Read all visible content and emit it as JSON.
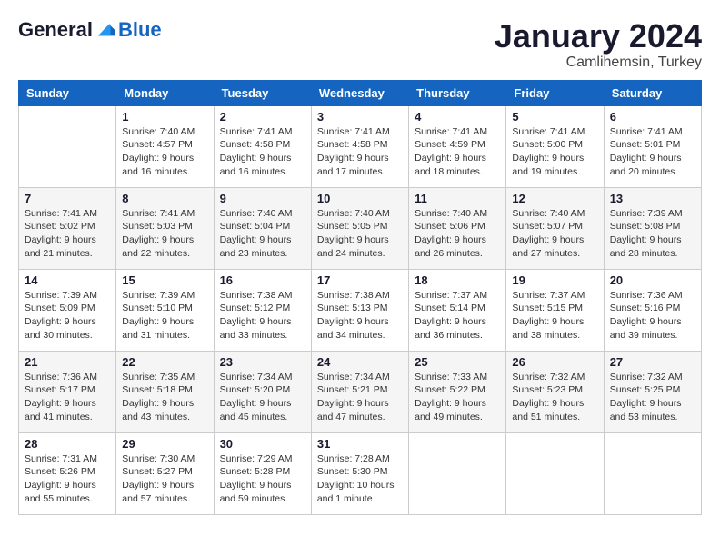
{
  "header": {
    "logo_general": "General",
    "logo_blue": "Blue",
    "month_title": "January 2024",
    "subtitle": "Camlihemsin, Turkey"
  },
  "weekdays": [
    "Sunday",
    "Monday",
    "Tuesday",
    "Wednesday",
    "Thursday",
    "Friday",
    "Saturday"
  ],
  "weeks": [
    [
      {
        "day": "",
        "info": ""
      },
      {
        "day": "1",
        "info": "Sunrise: 7:40 AM\nSunset: 4:57 PM\nDaylight: 9 hours\nand 16 minutes."
      },
      {
        "day": "2",
        "info": "Sunrise: 7:41 AM\nSunset: 4:58 PM\nDaylight: 9 hours\nand 16 minutes."
      },
      {
        "day": "3",
        "info": "Sunrise: 7:41 AM\nSunset: 4:58 PM\nDaylight: 9 hours\nand 17 minutes."
      },
      {
        "day": "4",
        "info": "Sunrise: 7:41 AM\nSunset: 4:59 PM\nDaylight: 9 hours\nand 18 minutes."
      },
      {
        "day": "5",
        "info": "Sunrise: 7:41 AM\nSunset: 5:00 PM\nDaylight: 9 hours\nand 19 minutes."
      },
      {
        "day": "6",
        "info": "Sunrise: 7:41 AM\nSunset: 5:01 PM\nDaylight: 9 hours\nand 20 minutes."
      }
    ],
    [
      {
        "day": "7",
        "info": "Sunrise: 7:41 AM\nSunset: 5:02 PM\nDaylight: 9 hours\nand 21 minutes."
      },
      {
        "day": "8",
        "info": "Sunrise: 7:41 AM\nSunset: 5:03 PM\nDaylight: 9 hours\nand 22 minutes."
      },
      {
        "day": "9",
        "info": "Sunrise: 7:40 AM\nSunset: 5:04 PM\nDaylight: 9 hours\nand 23 minutes."
      },
      {
        "day": "10",
        "info": "Sunrise: 7:40 AM\nSunset: 5:05 PM\nDaylight: 9 hours\nand 24 minutes."
      },
      {
        "day": "11",
        "info": "Sunrise: 7:40 AM\nSunset: 5:06 PM\nDaylight: 9 hours\nand 26 minutes."
      },
      {
        "day": "12",
        "info": "Sunrise: 7:40 AM\nSunset: 5:07 PM\nDaylight: 9 hours\nand 27 minutes."
      },
      {
        "day": "13",
        "info": "Sunrise: 7:39 AM\nSunset: 5:08 PM\nDaylight: 9 hours\nand 28 minutes."
      }
    ],
    [
      {
        "day": "14",
        "info": "Sunrise: 7:39 AM\nSunset: 5:09 PM\nDaylight: 9 hours\nand 30 minutes."
      },
      {
        "day": "15",
        "info": "Sunrise: 7:39 AM\nSunset: 5:10 PM\nDaylight: 9 hours\nand 31 minutes."
      },
      {
        "day": "16",
        "info": "Sunrise: 7:38 AM\nSunset: 5:12 PM\nDaylight: 9 hours\nand 33 minutes."
      },
      {
        "day": "17",
        "info": "Sunrise: 7:38 AM\nSunset: 5:13 PM\nDaylight: 9 hours\nand 34 minutes."
      },
      {
        "day": "18",
        "info": "Sunrise: 7:37 AM\nSunset: 5:14 PM\nDaylight: 9 hours\nand 36 minutes."
      },
      {
        "day": "19",
        "info": "Sunrise: 7:37 AM\nSunset: 5:15 PM\nDaylight: 9 hours\nand 38 minutes."
      },
      {
        "day": "20",
        "info": "Sunrise: 7:36 AM\nSunset: 5:16 PM\nDaylight: 9 hours\nand 39 minutes."
      }
    ],
    [
      {
        "day": "21",
        "info": "Sunrise: 7:36 AM\nSunset: 5:17 PM\nDaylight: 9 hours\nand 41 minutes."
      },
      {
        "day": "22",
        "info": "Sunrise: 7:35 AM\nSunset: 5:18 PM\nDaylight: 9 hours\nand 43 minutes."
      },
      {
        "day": "23",
        "info": "Sunrise: 7:34 AM\nSunset: 5:20 PM\nDaylight: 9 hours\nand 45 minutes."
      },
      {
        "day": "24",
        "info": "Sunrise: 7:34 AM\nSunset: 5:21 PM\nDaylight: 9 hours\nand 47 minutes."
      },
      {
        "day": "25",
        "info": "Sunrise: 7:33 AM\nSunset: 5:22 PM\nDaylight: 9 hours\nand 49 minutes."
      },
      {
        "day": "26",
        "info": "Sunrise: 7:32 AM\nSunset: 5:23 PM\nDaylight: 9 hours\nand 51 minutes."
      },
      {
        "day": "27",
        "info": "Sunrise: 7:32 AM\nSunset: 5:25 PM\nDaylight: 9 hours\nand 53 minutes."
      }
    ],
    [
      {
        "day": "28",
        "info": "Sunrise: 7:31 AM\nSunset: 5:26 PM\nDaylight: 9 hours\nand 55 minutes."
      },
      {
        "day": "29",
        "info": "Sunrise: 7:30 AM\nSunset: 5:27 PM\nDaylight: 9 hours\nand 57 minutes."
      },
      {
        "day": "30",
        "info": "Sunrise: 7:29 AM\nSunset: 5:28 PM\nDaylight: 9 hours\nand 59 minutes."
      },
      {
        "day": "31",
        "info": "Sunrise: 7:28 AM\nSunset: 5:30 PM\nDaylight: 10 hours\nand 1 minute."
      },
      {
        "day": "",
        "info": ""
      },
      {
        "day": "",
        "info": ""
      },
      {
        "day": "",
        "info": ""
      }
    ]
  ]
}
